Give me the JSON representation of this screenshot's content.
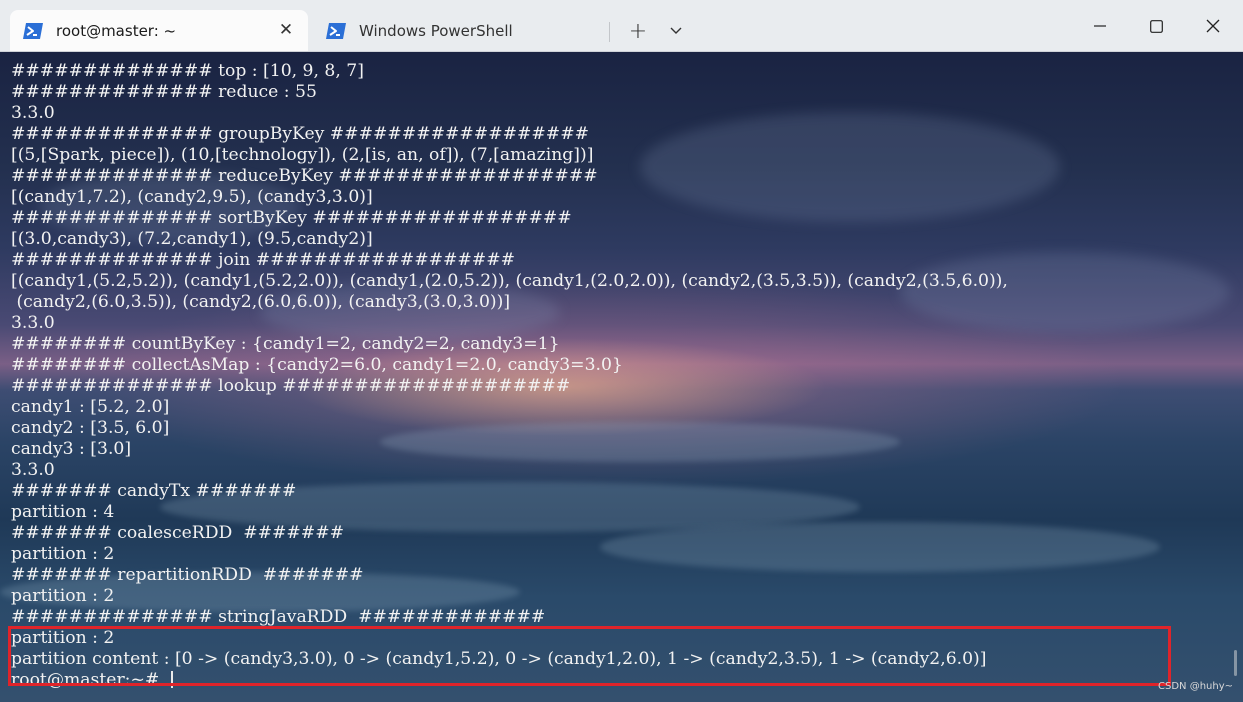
{
  "tabs": [
    {
      "label": "root@master: ~",
      "icon": "powershell-icon",
      "active": true
    },
    {
      "label": "Windows PowerShell",
      "icon": "powershell-icon",
      "active": false
    }
  ],
  "titlebar": {
    "new_tab": "+",
    "dropdown": "⌄",
    "close_tab": "✕"
  },
  "terminal": {
    "lines": [
      "############## top : [10, 9, 8, 7]",
      "############## reduce : 55",
      "3.3.0",
      "############## groupByKey ##################",
      "[(5,[Spark, piece]), (10,[technology]), (2,[is, an, of]), (7,[amazing])]",
      "############## reduceByKey ##################",
      "[(candy1,7.2), (candy2,9.5), (candy3,3.0)]",
      "############## sortByKey ##################",
      "[(3.0,candy3), (7.2,candy1), (9.5,candy2)]",
      "############## join ##################",
      "[(candy1,(5.2,5.2)), (candy1,(5.2,2.0)), (candy1,(2.0,5.2)), (candy1,(2.0,2.0)), (candy2,(3.5,3.5)), (candy2,(3.5,6.0)),",
      " (candy2,(6.0,3.5)), (candy2,(6.0,6.0)), (candy3,(3.0,3.0))]",
      "3.3.0",
      "######## countByKey : {candy1=2, candy2=2, candy3=1}",
      "######## collectAsMap : {candy2=6.0, candy1=2.0, candy3=3.0}",
      "############## lookup ####################",
      "candy1 : [5.2, 2.0]",
      "candy2 : [3.5, 6.0]",
      "candy3 : [3.0]",
      "3.3.0",
      "####### candyTx #######",
      "partition : 4",
      "####### coalesceRDD  #######",
      "partition : 2",
      "####### repartitionRDD  #######",
      "partition : 2",
      "############## stringJavaRDD  #############",
      "partition : 2",
      "partition content : [0 -> (candy3,3.0), 0 -> (candy1,5.2), 0 -> (candy1,2.0), 1 -> (candy2,3.5), 1 -> (candy2,6.0)]"
    ],
    "prompt": "root@master:~# "
  },
  "watermark": "CSDN @huhy~",
  "colors": {
    "highlight_box": "#e0242a",
    "terminal_text": "#f2f2f2",
    "titlebar_bg": "#e9ecef",
    "active_tab_bg": "#fbfbfb",
    "powershell_icon": "#2b6fd6"
  }
}
